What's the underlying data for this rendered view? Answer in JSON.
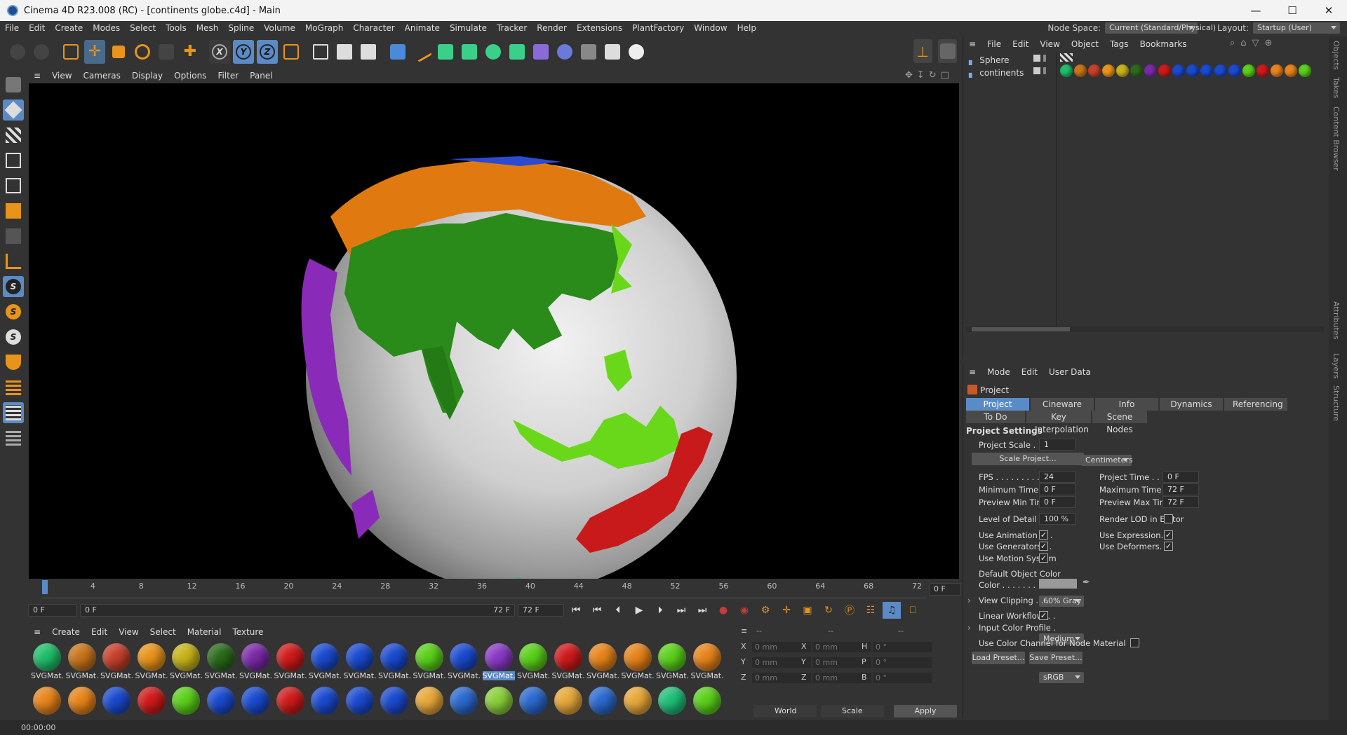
{
  "window": {
    "title": "Cinema 4D R23.008 (RC) - [continents globe.c4d] - Main"
  },
  "menu": [
    "File",
    "Edit",
    "Create",
    "Modes",
    "Select",
    "Tools",
    "Mesh",
    "Spline",
    "Volume",
    "MoGraph",
    "Character",
    "Animate",
    "Simulate",
    "Tracker",
    "Render",
    "Extensions",
    "PlantFactory",
    "Window",
    "Help"
  ],
  "nodespace": {
    "label": "Node Space:",
    "value": "Current (Standard/Physical)",
    "layout_label": "Layout:",
    "layout_value": "Startup (User)"
  },
  "viewport_menu": [
    "View",
    "Cameras",
    "Display",
    "Options",
    "Filter",
    "Panel"
  ],
  "timeline": {
    "ticks": [
      "0",
      "4",
      "8",
      "12",
      "16",
      "20",
      "24",
      "28",
      "32",
      "36",
      "40",
      "44",
      "48",
      "52",
      "56",
      "60",
      "64",
      "68",
      "72"
    ],
    "current_frame": "0 F"
  },
  "playbar": {
    "start": "0 F",
    "range_start": "0 F",
    "range_end": "72 F",
    "end": "72 F"
  },
  "material_menu": [
    "Create",
    "Edit",
    "View",
    "Select",
    "Material",
    "Texture"
  ],
  "materials_row1": [
    {
      "label": "SVGMat.",
      "color": "#1fbf6a"
    },
    {
      "label": "SVGMat.",
      "color": "#c8741a"
    },
    {
      "label": "SVGMat.",
      "color": "#c8402a"
    },
    {
      "label": "SVGMat.",
      "color": "#e8941a"
    },
    {
      "label": "SVGMat.",
      "color": "#c8b41a"
    },
    {
      "label": "SVGMat.",
      "color": "#2a6a1a"
    },
    {
      "label": "SVGMat.",
      "color": "#7a2aa8"
    },
    {
      "label": "SVGMat.",
      "color": "#d01a1a"
    },
    {
      "label": "SVGMat.",
      "color": "#1a4ad0"
    },
    {
      "label": "SVGMat.",
      "color": "#1a4ad0"
    },
    {
      "label": "SVGMat.",
      "color": "#1a4ad0"
    },
    {
      "label": "SVGMat.",
      "color": "#5ad01a"
    },
    {
      "label": "SVGMat.",
      "color": "#1a4ad0"
    },
    {
      "label": "SVGMat.",
      "color": "#8a3ac8"
    },
    {
      "label": "SVGMat.",
      "color": "#5ad01a"
    },
    {
      "label": "SVGMat.",
      "color": "#d01a1a"
    },
    {
      "label": "SVGMat.",
      "color": "#e8841a"
    },
    {
      "label": "SVGMat.",
      "color": "#e8841a"
    },
    {
      "label": "SVGMat.",
      "color": "#5ad01a"
    },
    {
      "label": "SVGMat.",
      "color": "#e8841a"
    }
  ],
  "materials_row2": [
    "#e8841a",
    "#e8841a",
    "#1a4ad0",
    "#d01a1a",
    "#5ad01a",
    "#1a4ad0",
    "#1a4ad0",
    "#d01a1a",
    "#1a4ad0",
    "#1a4ad0",
    "#1a4ad0",
    "#e8a83a",
    "#2a6ad0",
    "#8ad03a",
    "#2a6ad0",
    "#e8a83a",
    "#2a6ad0",
    "#e8a83a",
    "#1fbf7a",
    "#5ad01a"
  ],
  "coords": {
    "headers": [
      "--",
      "--",
      "--"
    ],
    "rows": [
      {
        "a": "X",
        "av": "0 mm",
        "b": "X",
        "bv": "0 mm",
        "c": "H",
        "cv": "0 °"
      },
      {
        "a": "Y",
        "av": "0 mm",
        "b": "Y",
        "bv": "0 mm",
        "c": "P",
        "cv": "0 °"
      },
      {
        "a": "Z",
        "av": "0 mm",
        "b": "Z",
        "bv": "0 mm",
        "c": "B",
        "cv": "0 °"
      }
    ],
    "world": "World",
    "scale": "Scale",
    "apply": "Apply"
  },
  "status": {
    "time": "00:00:00"
  },
  "object_menu": [
    "File",
    "Edit",
    "View",
    "Object",
    "Tags",
    "Bookmarks"
  ],
  "objects": [
    {
      "name": "Sphere"
    },
    {
      "name": "continents"
    }
  ],
  "tag_colors": [
    "#1fbf6a",
    "#c8741a",
    "#c8402a",
    "#e8941a",
    "#c8b41a",
    "#2a6a1a",
    "#7a2aa8",
    "#d01a1a",
    "#1a4ad0",
    "#1a4ad0",
    "#1a4ad0",
    "#1a4ad0",
    "#1a4ad0",
    "#5ad01a",
    "#d01a1a",
    "#e8841a",
    "#e8841a",
    "#5ad01a"
  ],
  "attr_menu": [
    "Mode",
    "Edit",
    "User Data"
  ],
  "attr": {
    "object": "Project",
    "tabs1": [
      "Project Settings",
      "Cineware",
      "Info",
      "Dynamics",
      "Referencing"
    ],
    "tabs2": [
      "To Do",
      "Key Interpolation",
      "Scene Nodes"
    ],
    "section": "Project Settings",
    "project_scale_label": "Project Scale . . . .",
    "project_scale": "1",
    "units": "Centimeters",
    "scale_project": "Scale Project...",
    "fps_label": "FPS . . . . . . . . .",
    "fps": "24",
    "project_time_label": "Project Time . . . .",
    "project_time": "0 F",
    "min_time_label": "Minimum Time . .",
    "min_time": "0 F",
    "max_time_label": "Maximum Time . .",
    "max_time": "72 F",
    "prev_min_label": "Preview Min Time.",
    "prev_min": "0 F",
    "prev_max_label": "Preview Max Time.",
    "prev_max": "72 F",
    "lod_label": "Level of Detail . . .",
    "lod": "100 %",
    "render_lod_label": "Render LOD in Editor",
    "use_anim_label": "Use Animation . . .",
    "use_expr_label": "Use Expression. . .",
    "use_gen_label": "Use Generators . .",
    "use_def_label": "Use Deformers. . .",
    "use_motion_label": "Use Motion System",
    "def_color_label": "Default Object Color",
    "def_color": "60% Gray",
    "color_label": "Color . . . . . . . .",
    "view_clip_label": "View Clipping . . .",
    "view_clip": "Medium",
    "linear_label": "Linear Workflow. . .",
    "input_profile_label": "Input Color Profile .",
    "input_profile": "sRGB",
    "color_channel_label": "Use Color Channel for Node Material",
    "load_preset": "Load Preset...",
    "save_preset": "Save Preset..."
  },
  "side_tabs": [
    "Objects",
    "Takes",
    "Content Browser",
    "Attributes",
    "Layers",
    "Structure"
  ]
}
